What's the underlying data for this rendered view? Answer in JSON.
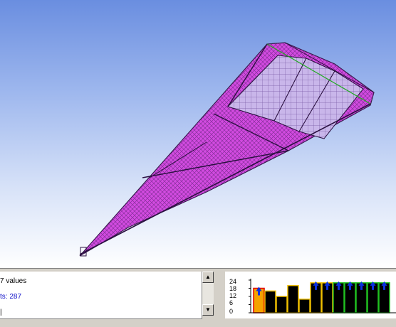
{
  "log": {
    "line1": "7 values",
    "line2": "ts: 287",
    "line3": "|"
  },
  "scrollbar": {
    "up_icon": "▲",
    "down_icon": "▼"
  },
  "histogram": {
    "y_ticks": [
      "24",
      "18",
      "12",
      "6",
      "0"
    ],
    "bars": [
      {
        "value": 18,
        "fill": "#f5a300",
        "outline": "#e00000"
      },
      {
        "value": 16,
        "fill": "#000000",
        "outline": "#f0c000"
      },
      {
        "value": 12,
        "fill": "#000000",
        "outline": "#f0c000"
      },
      {
        "value": 20,
        "fill": "#000000",
        "outline": "#f0c000"
      },
      {
        "value": 10,
        "fill": "#000000",
        "outline": "#f0c000"
      },
      {
        "value": 22,
        "fill": "#000000",
        "outline": "#f0c000"
      },
      {
        "value": 22,
        "fill": "#000000",
        "outline": "#f0c000"
      },
      {
        "value": 22,
        "fill": "#000000",
        "outline": "#20c020"
      },
      {
        "value": 22,
        "fill": "#000000",
        "outline": "#20c020"
      },
      {
        "value": 22,
        "fill": "#000000",
        "outline": "#20c020"
      },
      {
        "value": 22,
        "fill": "#000000",
        "outline": "#20c020"
      },
      {
        "value": 22,
        "fill": "#000000",
        "outline": "#20c020"
      }
    ],
    "y_max": 24,
    "marker_color": "#0a2fe0"
  },
  "viewport": {
    "mesh_color": "#d24be0",
    "mesh_dark": "#3a1a50",
    "edge_color": "#22aa22"
  }
}
